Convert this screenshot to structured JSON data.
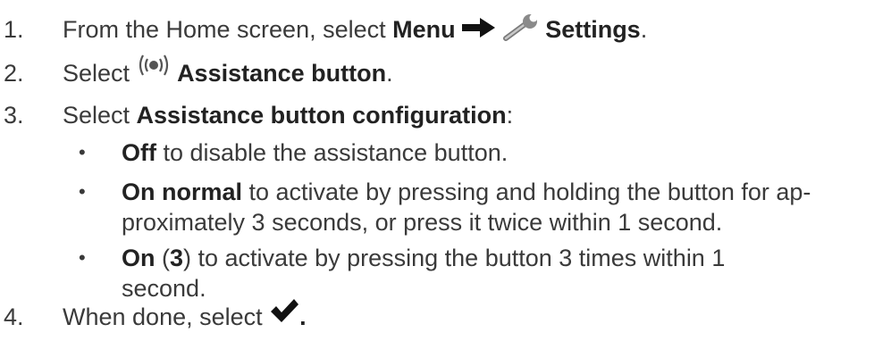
{
  "steps": [
    {
      "num": "1.",
      "pre": "From the Home screen, select ",
      "b1": "Menu",
      "b2": "Settings",
      "post": "."
    },
    {
      "num": "2.",
      "pre": "Select ",
      "b1": "Assistance button",
      "post": "."
    },
    {
      "num": "3.",
      "pre": "Select ",
      "b1": "Assistance button configuration",
      "post": ":"
    },
    {
      "num": "4.",
      "pre": "When done, select ",
      "post": "."
    }
  ],
  "bullets": [
    {
      "b": "Off",
      "line1": " to disable the assistance button.",
      "line2": ""
    },
    {
      "b": "On normal",
      "line1": " to activate by pressing and holding the button for ap-",
      "line2": "proximately 3 seconds, or press it twice within 1 second."
    },
    {
      "b": "On",
      "mid": " (",
      "b2": "3",
      "line1": ") to activate by pressing the button 3 times within 1",
      "line2": "second."
    }
  ],
  "bullet_glyph": "•",
  "icons": {
    "arrow": "right-arrow-icon",
    "wrench": "wrench-icon",
    "radio": "radio-waves-icon",
    "check": "checkmark-icon"
  }
}
